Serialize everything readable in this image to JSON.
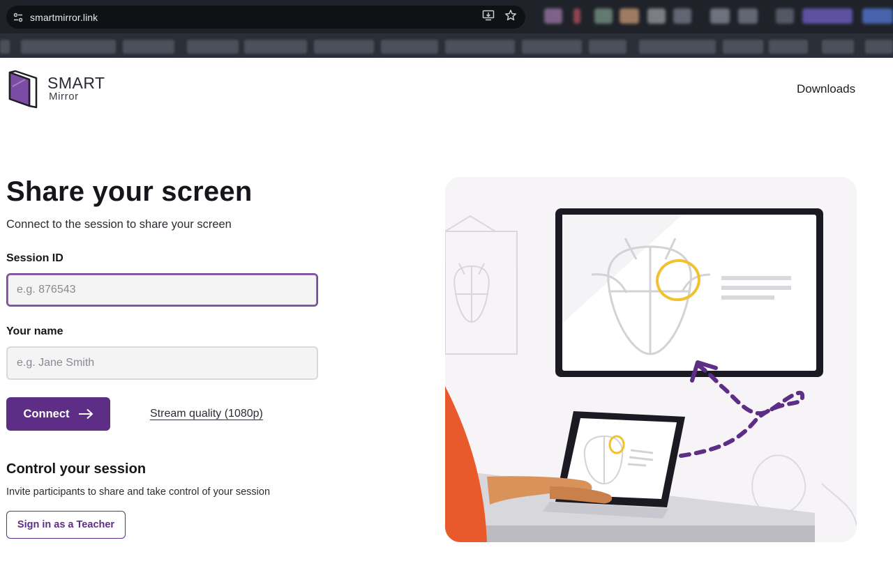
{
  "browser": {
    "url": "smartmirror.link",
    "icons": [
      "site-settings-icon",
      "install-app-icon",
      "bookmark-star-icon"
    ]
  },
  "header": {
    "logo_title": "SMART",
    "logo_subtitle": "Mirror",
    "nav_downloads": "Downloads"
  },
  "hero": {
    "title": "Share your screen",
    "subtitle": "Connect to the session to share your screen"
  },
  "form": {
    "session_label": "Session ID",
    "session_placeholder": "e.g. 876543",
    "session_value": "",
    "name_label": "Your name",
    "name_placeholder": "e.g. Jane Smith",
    "name_value": "",
    "connect_label": "Connect",
    "stream_quality_label": "Stream quality (1080p)"
  },
  "control": {
    "title": "Control your session",
    "subtitle": "Invite participants to share and take control of your session",
    "teacher_button": "Sign in as a Teacher"
  },
  "colors": {
    "brand": "#5e2d86",
    "highlight": "#f2c12e",
    "accent_orange": "#e85a2c"
  }
}
